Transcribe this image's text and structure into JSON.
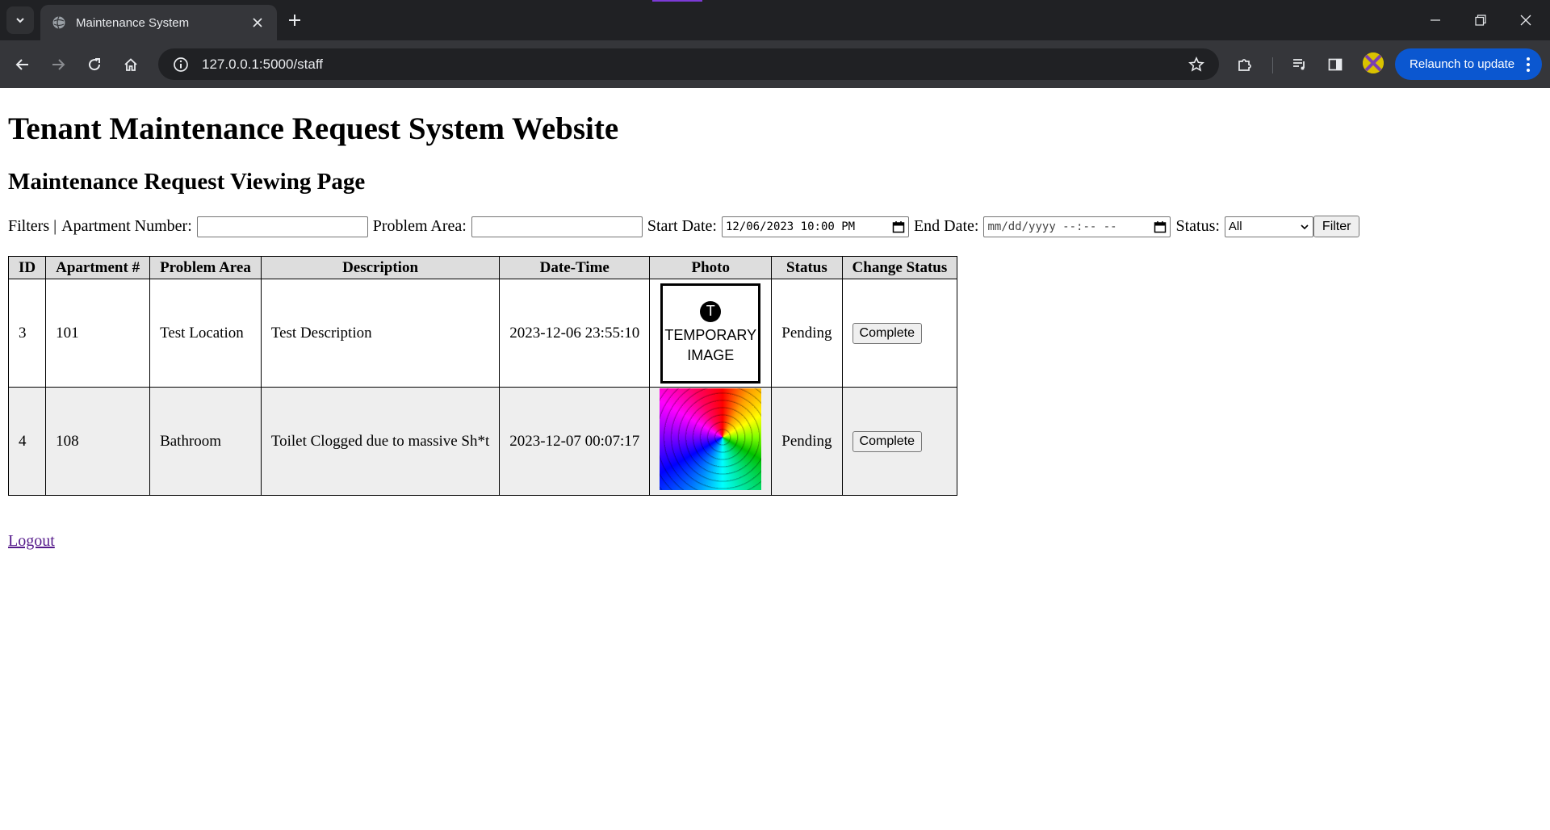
{
  "browser": {
    "tab_title": "Maintenance System",
    "url": "127.0.0.1:5000/staff",
    "relaunch_label": "Relaunch to update",
    "accent_color": "#0b57d0"
  },
  "page": {
    "site_title": "Tenant Maintenance Request System Website",
    "page_title": "Maintenance Request Viewing Page",
    "filters": {
      "prefix": "Filters |",
      "apartment_label": "Apartment Number:",
      "apartment_value": "",
      "problem_area_label": "Problem Area:",
      "problem_area_value": "",
      "start_date_label": "Start Date:",
      "start_date_value": "12/06/2023 10:00 PM",
      "end_date_label": "End Date:",
      "end_date_value": "mm/dd/yyyy --:-- --",
      "status_label": "Status:",
      "status_value": "All",
      "filter_button": "Filter"
    },
    "table": {
      "headers": [
        "ID",
        "Apartment #",
        "Problem Area",
        "Description",
        "Date-Time",
        "Photo",
        "Status",
        "Change Status"
      ],
      "rows": [
        {
          "id": "3",
          "apartment": "101",
          "problem_area": "Test Location",
          "description": "Test Description",
          "datetime": "2023-12-06 23:55:10",
          "photo_text_line1": "TEMPORARY",
          "photo_text_line2": "IMAGE",
          "photo_badge": "T",
          "status": "Pending",
          "action": "Complete"
        },
        {
          "id": "4",
          "apartment": "108",
          "problem_area": "Bathroom",
          "description": "Toilet Clogged due to massive Sh*t",
          "datetime": "2023-12-07 00:07:17",
          "status": "Pending",
          "action": "Complete"
        }
      ]
    },
    "logout_label": "Logout"
  }
}
